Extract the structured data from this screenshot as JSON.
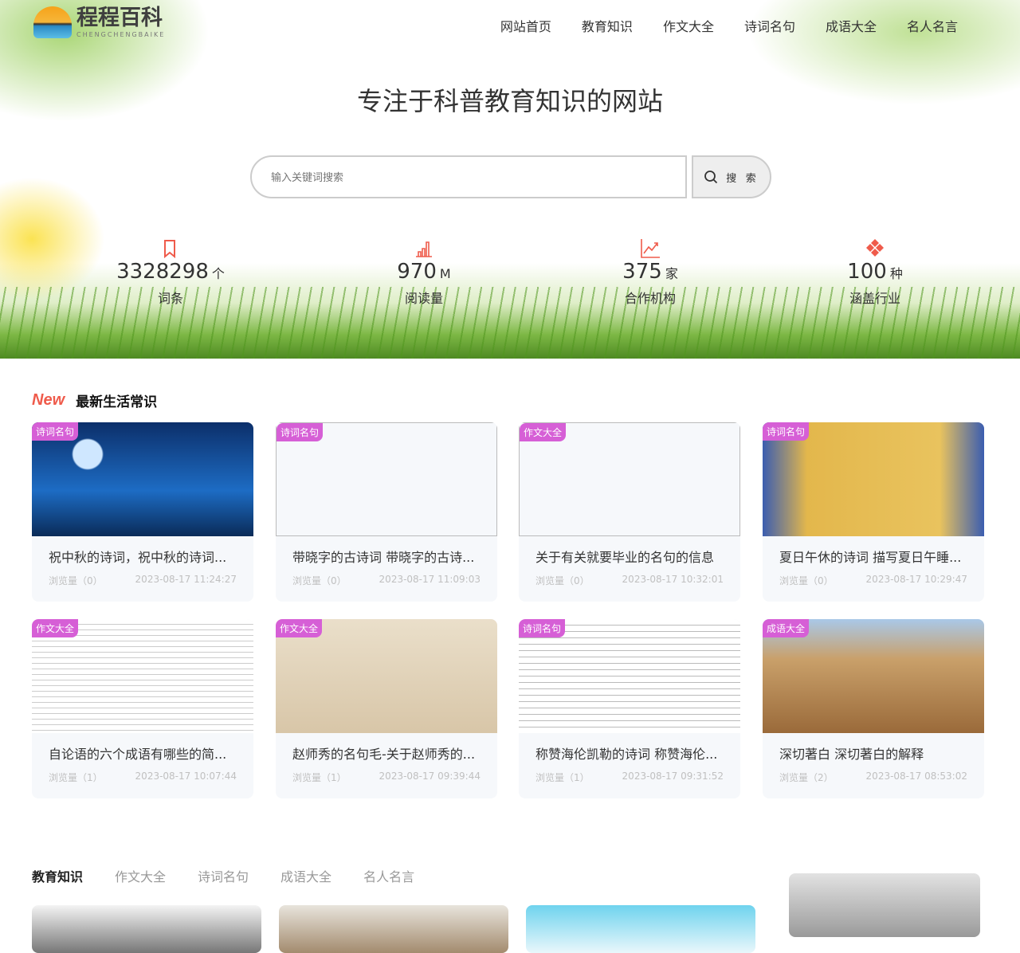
{
  "header": {
    "logo_text": "程程百科",
    "logo_sub": "CHENGCHENGBAIKE",
    "nav": [
      "网站首页",
      "教育知识",
      "作文大全",
      "诗词名句",
      "成语大全",
      "名人名言"
    ]
  },
  "hero": {
    "slogan": "专注于科普教育知识的网站",
    "search_placeholder": "输入关键词搜索",
    "search_button": "搜 索",
    "stats": [
      {
        "num": "3328298",
        "unit": "个",
        "label": "词条",
        "icon": "bookmark-icon"
      },
      {
        "num": "970",
        "unit": "M",
        "label": "阅读量",
        "icon": "bar-chart-icon"
      },
      {
        "num": "375",
        "unit": "家",
        "label": "合作机构",
        "icon": "trend-chart-icon"
      },
      {
        "num": "100",
        "unit": "种",
        "label": "涵盖行业",
        "icon": "diamond-grid-icon"
      }
    ],
    "accent": "#ef5b4b"
  },
  "latest": {
    "badge": "New",
    "title": "最新生活常识",
    "cards": [
      {
        "tag": "诗词名句",
        "title": "祝中秋的诗词，祝中秋的诗词...",
        "views": "浏览量（0）",
        "date": "2023-08-17 11:24:27"
      },
      {
        "tag": "诗词名句",
        "title": "带晓字的古诗词 带晓字的古诗...",
        "views": "浏览量（0）",
        "date": "2023-08-17 11:09:03"
      },
      {
        "tag": "作文大全",
        "title": "关于有关就要毕业的名句的信息",
        "views": "浏览量（0）",
        "date": "2023-08-17 10:32:01"
      },
      {
        "tag": "诗词名句",
        "title": "夏日午休的诗词 描写夏日午睡...",
        "views": "浏览量（0）",
        "date": "2023-08-17 10:29:47"
      },
      {
        "tag": "作文大全",
        "title": "自论语的六个成语有哪些的简...",
        "views": "浏览量（1）",
        "date": "2023-08-17 10:07:44"
      },
      {
        "tag": "作文大全",
        "title": "赵师秀的名句毛-关于赵师秀的...",
        "views": "浏览量（1）",
        "date": "2023-08-17 09:39:44"
      },
      {
        "tag": "诗词名句",
        "title": "称赞海伦凯勒的诗词 称赞海伦...",
        "views": "浏览量（1）",
        "date": "2023-08-17 09:31:52"
      },
      {
        "tag": "成语大全",
        "title": "深切著白 深切著白的解释",
        "views": "浏览量（2）",
        "date": "2023-08-17 08:53:02"
      }
    ]
  },
  "bottom": {
    "tabs": [
      "教育知识",
      "作文大全",
      "诗词名句",
      "成语大全",
      "名人名言"
    ]
  }
}
